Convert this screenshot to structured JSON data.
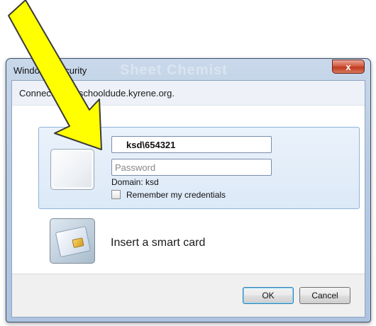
{
  "window": {
    "title": "Windows Security",
    "title_ghost": "Sheet Chemist",
    "close_label": "x"
  },
  "dialog": {
    "connecting_text": "Connecting to schooldude.kyrene.org."
  },
  "credentials": {
    "username_value": "ksd\\654321",
    "password_placeholder": "Password",
    "domain_text": "Domain: ksd",
    "remember_label": "Remember my credentials"
  },
  "smart_card": {
    "label": "Insert a smart card"
  },
  "buttons": {
    "ok": "OK",
    "cancel": "Cancel"
  },
  "annotation": {
    "arrow_color": "#ffff00",
    "arrow_outline": "#3a3a3a"
  }
}
